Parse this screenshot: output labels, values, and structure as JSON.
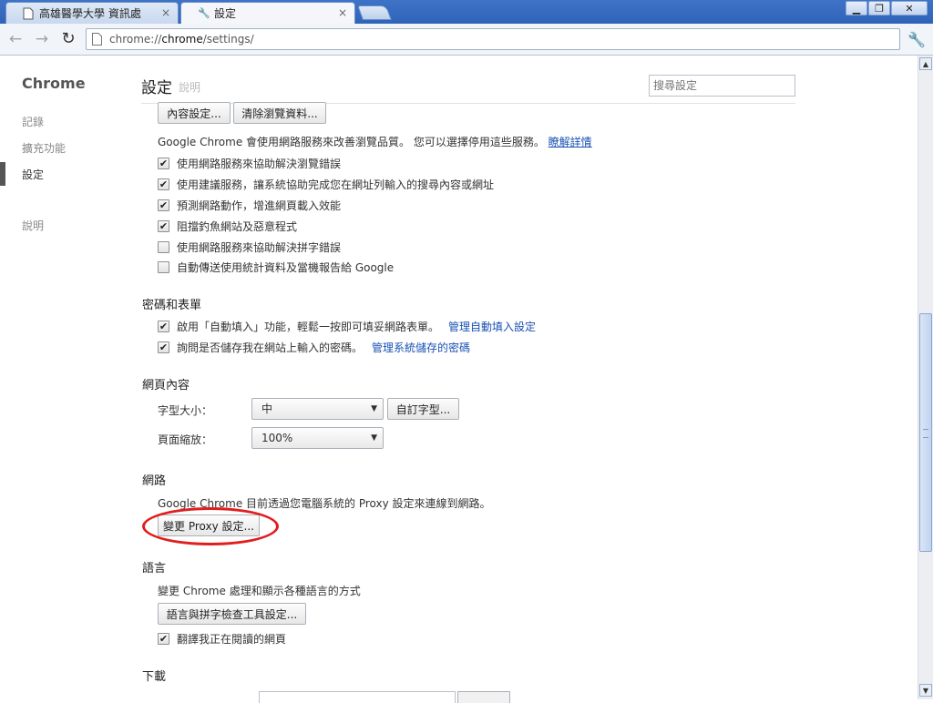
{
  "tabs": [
    {
      "title": "高雄醫學大學 資訊處",
      "close": "×"
    },
    {
      "title": "設定",
      "close": "×"
    }
  ],
  "window_controls": {
    "minimize": "▁",
    "maximize": "❐",
    "close": "✕"
  },
  "toolbar": {
    "back": "←",
    "forward": "→",
    "reload": "↻",
    "url_prefix": "chrome://",
    "url_host": "chrome",
    "url_path": "/settings/",
    "star": "☆",
    "wrench": "🔧"
  },
  "sidebar": {
    "title": "Chrome",
    "items": [
      "記錄",
      "擴充功能",
      "設定",
      "說明"
    ]
  },
  "header": {
    "title": "設定",
    "ghost_text": "說明",
    "search_placeholder": "搜尋設定"
  },
  "privacy": {
    "content_settings": "內容設定...",
    "clear_data": "清除瀏覽資料...",
    "description": "Google Chrome 會使用網路服務來改善瀏覽品質。 您可以選擇停用這些服務。",
    "learn_more": "瞭解詳情",
    "checkboxes": [
      {
        "label": "使用網路服務來協助解決瀏覽錯誤",
        "checked": true
      },
      {
        "label": "使用建議服務，讓系統協助完成您在網址列輸入的搜尋內容或網址",
        "checked": true
      },
      {
        "label": "預測網路動作，增進網頁載入效能",
        "checked": true
      },
      {
        "label": "阻擋釣魚網站及惡意程式",
        "checked": true
      },
      {
        "label": "使用網路服務來協助解決拼字錯誤",
        "checked": false
      },
      {
        "label": "自動傳送使用統計資料及當機報告給 Google",
        "checked": false
      }
    ]
  },
  "passwords": {
    "heading": "密碼和表單",
    "autofill_label": "啟用「自動填入」功能，輕鬆一按即可填妥網路表單。",
    "autofill_link": "管理自動填入設定",
    "save_pw_label": "詢問是否儲存我在網站上輸入的密碼。",
    "save_pw_link": "管理系統儲存的密碼"
  },
  "web_content": {
    "heading": "網頁內容",
    "font_size_label": "字型大小：",
    "font_size_value": "中",
    "custom_fonts": "自訂字型...",
    "zoom_label": "頁面縮放：",
    "zoom_value": "100%"
  },
  "network": {
    "heading": "網路",
    "description": "Google Chrome 目前透過您電腦系統的 Proxy 設定來連線到網路。",
    "proxy_button": "變更 Proxy 設定..."
  },
  "languages": {
    "heading": "語言",
    "description": "變更 Chrome 處理和顯示各種語言的方式",
    "settings_button": "語言與拼字檢查工具設定...",
    "translate_label": "翻譯我正在閱讀的網頁"
  },
  "downloads": {
    "heading": "下載"
  },
  "scrollbar": {
    "up": "▲",
    "down": "▼"
  },
  "colors": {
    "link": "#1a51b3",
    "annotation": "#e11d1d",
    "titlebar": "#3e73c7"
  }
}
